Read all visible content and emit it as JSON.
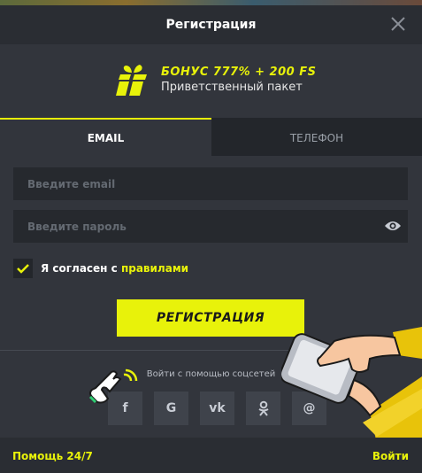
{
  "header": {
    "title": "Регистрация",
    "close_icon": "close-icon"
  },
  "bonus": {
    "title": "БОНУС 777% + 200 FS",
    "subtitle": "Приветственный пакет",
    "icon": "gift-icon"
  },
  "tabs": [
    {
      "label": "EMAIL",
      "active": true
    },
    {
      "label": "ТЕЛЕФОН",
      "active": false
    }
  ],
  "form": {
    "email_placeholder": "Введите email",
    "password_placeholder": "Введите пароль",
    "agree_prefix": "Я согласен с ",
    "agree_link": "правилами",
    "agree_checked": true,
    "submit_label": "РЕГИСТРАЦИЯ"
  },
  "social": {
    "title": "Войти с помощью соцсетей",
    "buttons": [
      {
        "icon": "facebook-icon",
        "glyph": "f"
      },
      {
        "icon": "google-icon",
        "glyph": "G"
      },
      {
        "icon": "vk-icon",
        "glyph": "vk"
      },
      {
        "icon": "odnoklassniki-icon",
        "glyph": "ok"
      },
      {
        "icon": "mail-icon",
        "glyph": "@"
      }
    ]
  },
  "footer": {
    "help": "Помощь 24/7",
    "login": "Войти"
  },
  "colors": {
    "accent": "#e8f20a",
    "background": "#32353c",
    "input": "#26292e"
  }
}
